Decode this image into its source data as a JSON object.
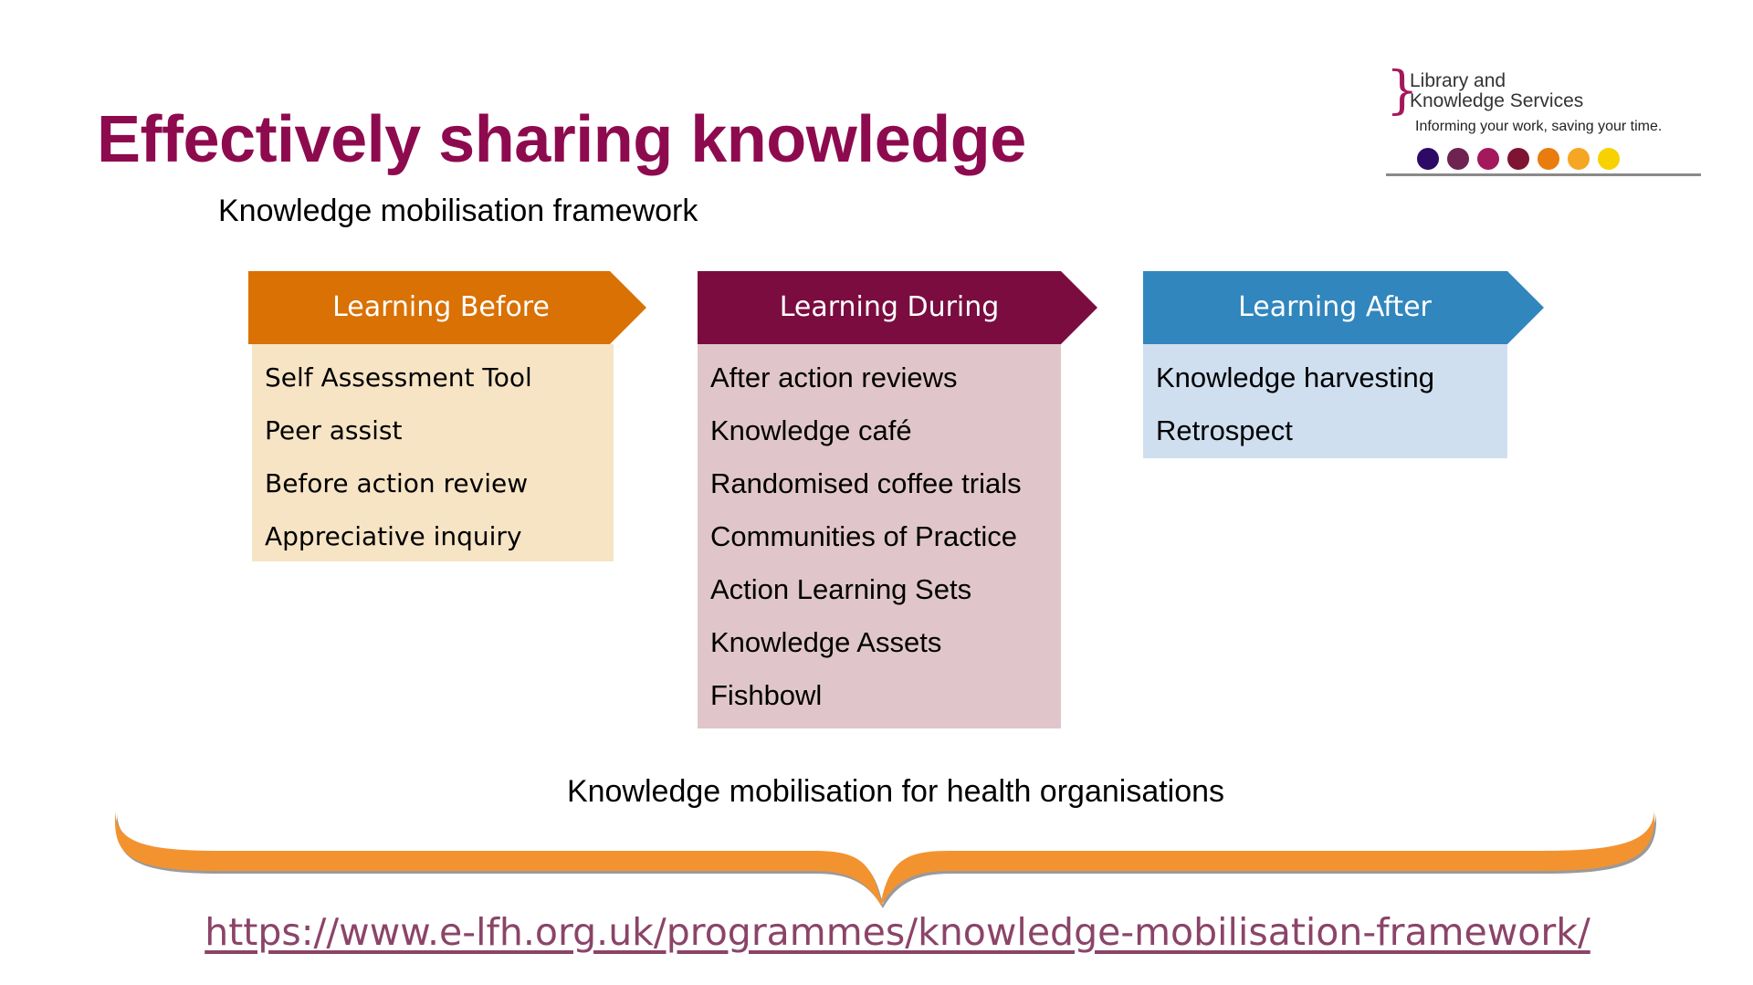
{
  "slide": {
    "title": "Effectively sharing knowledge",
    "subtitle": "Knowledge mobilisation framework"
  },
  "logo": {
    "line1": "Library and",
    "line2": "Knowledge Services",
    "tagline": "Informing your work, saving your time.",
    "brace_glyph": "}",
    "dot_colors": [
      "#2d0a66",
      "#6e2350",
      "#a3195b",
      "#7f1333",
      "#e87c0c",
      "#f5a623",
      "#f7d100"
    ]
  },
  "columns": [
    {
      "title": "Learning Before",
      "header_color": "#d97104",
      "body_color": "#f6e4c5",
      "items": [
        "Self Assessment Tool",
        "Peer assist",
        "Before action review",
        "Appreciative inquiry"
      ]
    },
    {
      "title": "Learning During",
      "header_color": "#7a0c40",
      "body_color": "#e0c6ca",
      "items": [
        "After action reviews",
        "Knowledge café",
        "Randomised coffee trials",
        "Communities of Practice",
        "Action Learning Sets",
        "Knowledge Assets",
        "Fishbowl"
      ]
    },
    {
      "title": "Learning After",
      "header_color": "#3186be",
      "body_color": "#cfdfef",
      "items": [
        "Knowledge harvesting",
        "Retrospect"
      ]
    }
  ],
  "footer": {
    "label": "Knowledge mobilisation for health organisations",
    "brace_color": "#f39330",
    "url": "https://www.e-lfh.org.uk/programmes/knowledge-mobilisation-framework/"
  }
}
